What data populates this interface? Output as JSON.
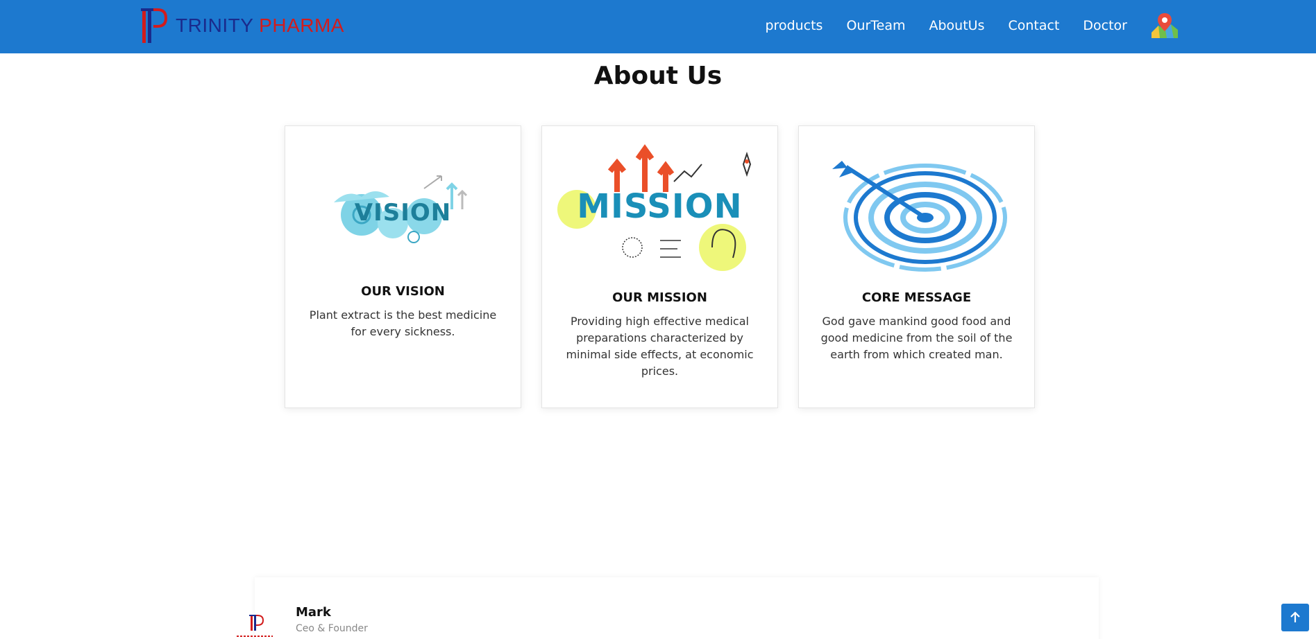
{
  "brand": {
    "word1": "TRINITY",
    "word2": "PHARMA",
    "primary_color": "#1a2a8c",
    "accent_color": "#d21c1c"
  },
  "header": {
    "background": "#1d79cf"
  },
  "nav": {
    "items": [
      "products",
      "OurTeam",
      "AboutUs",
      "Contact",
      "Doctor"
    ],
    "map_icon": "map-pin-icon"
  },
  "about": {
    "title": "About Us",
    "cards": [
      {
        "image_text": "VISION",
        "title": "OUR VISION",
        "text": "Plant extract is the best medicine for every sickness."
      },
      {
        "image_text": "MISSION",
        "title": "OUR MISSION",
        "text": "Providing high effective medical preparations characterized by minimal side effects, at economic prices."
      },
      {
        "image_text": "",
        "title": "CORE MESSAGE",
        "text": "God gave mankind good food and good medicine from the soil of the earth from which created man."
      }
    ]
  },
  "team": {
    "members": [
      {
        "name": "Mark",
        "role": "Ceo & Founder"
      }
    ]
  },
  "back_to_top_icon": "arrow-up-icon"
}
